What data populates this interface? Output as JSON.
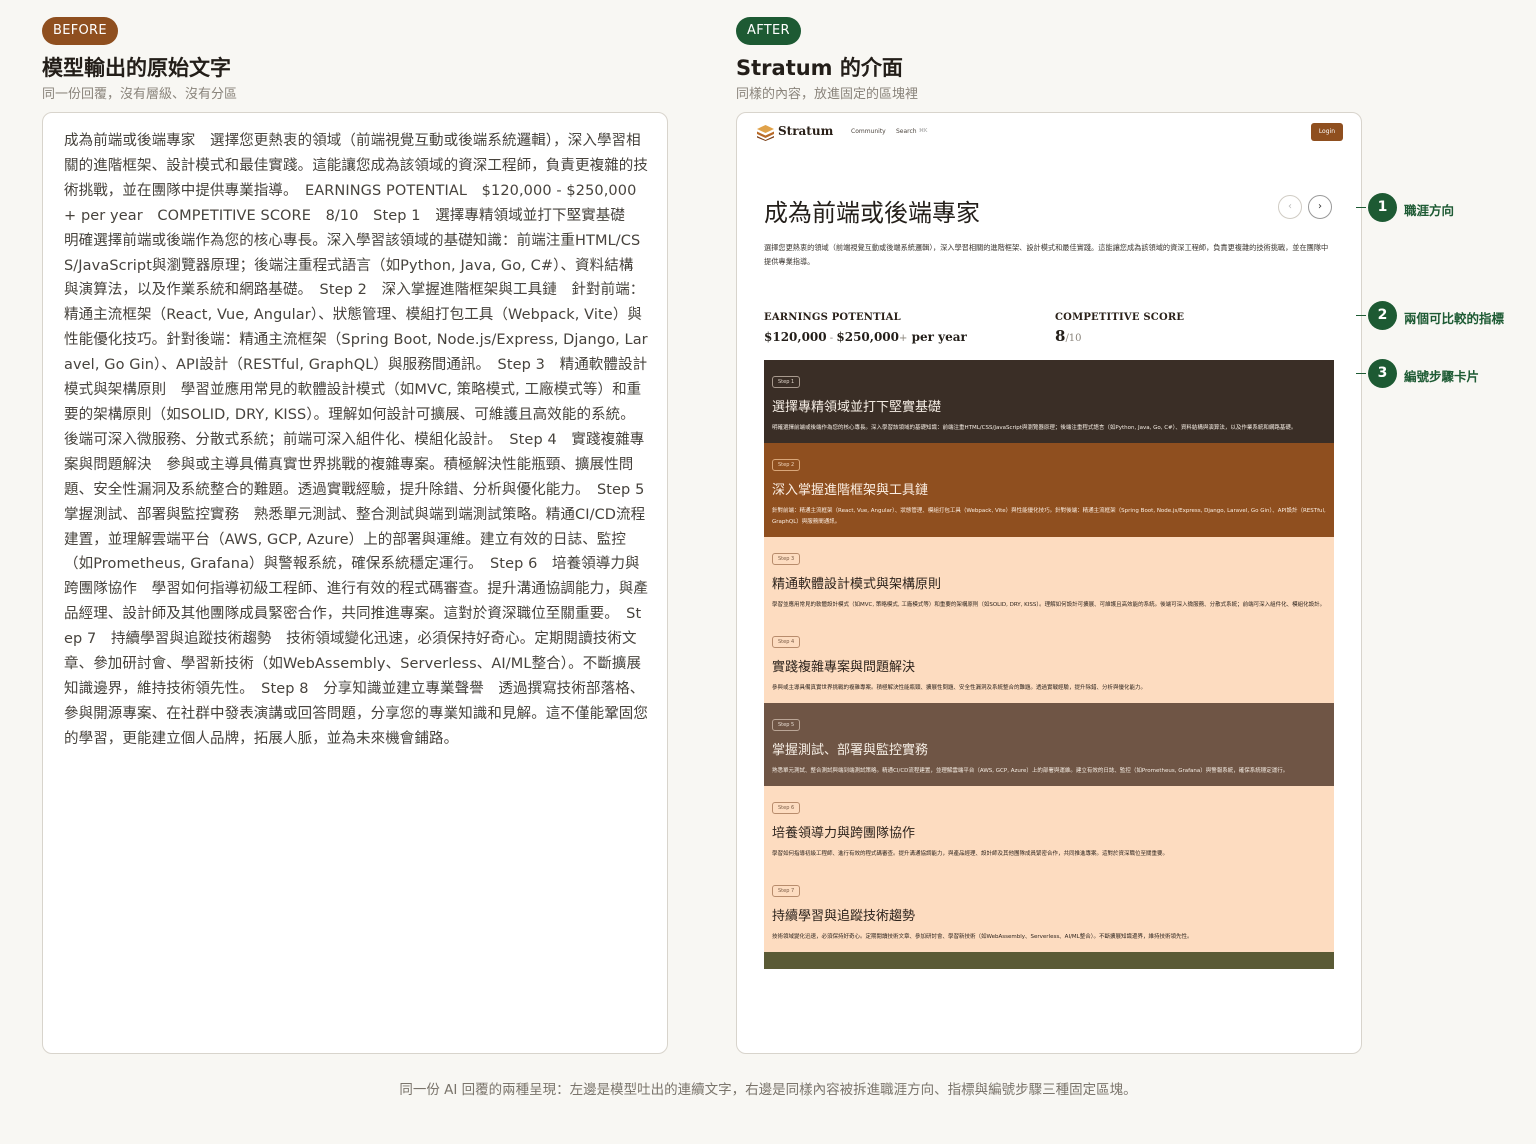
{
  "before": {
    "badge": "BEFORE",
    "title": "模型輸出的原始文字",
    "subtitle": "同一份回覆，沒有層級、沒有分區",
    "raw_text": "成為前端或後端專家　選擇您更熱衷的領域（前端視覺互動或後端系統邏輯），深入學習相關的進階框架、設計模式和最佳實踐。這能讓您成為該領域的資深工程師，負責更複雜的技術挑戰，並在團隊中提供專業指導。　EARNINGS POTENTIAL　$120,000 - $250,000+ per year　COMPETITIVE SCORE　8/10　Step 1　選擇專精領域並打下堅實基礎　明確選擇前端或後端作為您的核心專長。深入學習該領域的基礎知識：前端注重HTML/CSS/JavaScript與瀏覽器原理；後端注重程式語言（如Python, Java, Go, C#）、資料結構與演算法，以及作業系統和網路基礎。　Step 2　深入掌握進階框架與工具鏈　針對前端：精通主流框架（React, Vue, Angular）、狀態管理、模組打包工具（Webpack, Vite）與性能優化技巧。針對後端：精通主流框架（Spring Boot, Node.js/Express, Django, Laravel, Go Gin）、API設計（RESTful, GraphQL）與服務間通訊。　Step 3　精通軟體設計模式與架構原則　學習並應用常見的軟體設計模式（如MVC, 策略模式, 工廠模式等）和重要的架構原則（如SOLID, DRY, KISS）。理解如何設計可擴展、可維護且高效能的系統。後端可深入微服務、分散式系統；前端可深入組件化、模組化設計。　Step 4　實踐複雜專案與問題解決　參與或主導具備真實世界挑戰的複雜專案。積極解決性能瓶頸、擴展性問題、安全性漏洞及系統整合的難題。透過實戰經驗，提升除錯、分析與優化能力。　Step 5　掌握測試、部署與監控實務　熟悉單元測試、整合測試與端到端測試策略。精通CI/CD流程建置，並理解雲端平台（AWS, GCP, Azure）上的部署與運維。建立有效的日誌、監控（如Prometheus, Grafana）與警報系統，確保系統穩定運行。　Step 6　培養領導力與跨團隊協作　學習如何指導初級工程師、進行有效的程式碼審查。提升溝通協調能力，與產品經理、設計師及其他團隊成員緊密合作，共同推進專案。這對於資深職位至關重要。　Step 7　持續學習與追蹤技術趨勢　技術領域變化迅速，必須保持好奇心。定期閱讀技術文章、參加研討會、學習新技術（如WebAssembly、Serverless、AI/ML整合）。不斷擴展知識邊界，維持技術領先性。　Step 8　分享知識並建立專業聲譽　透過撰寫技術部落格、參與開源專案、在社群中發表演講或回答問題，分享您的專業知識和見解。這不僅能鞏固您的學習，更能建立個人品牌，拓展人脈，並為未來機會鋪路。"
  },
  "after": {
    "badge": "AFTER",
    "title": "Stratum 的介面",
    "subtitle": "同樣的內容，放進固定的區塊裡",
    "app": {
      "logo": "Stratum",
      "nav": {
        "community": "Community",
        "search": "Search",
        "search_kbd": "⌘K",
        "login": "Login"
      },
      "hero_title": "成為前端或後端專家",
      "prev_icon": "‹",
      "next_icon": "›",
      "hero_desc": "選擇您更熱衷的領域（前端視覺互動或後端系統邏輯），深入學習相關的進階框架、設計模式和最佳實踐。這能讓您成為該領域的資深工程師，負責更複雜的技術挑戰，並在團隊中提供專業指導。",
      "earnings": {
        "label": "EARNINGS POTENTIAL",
        "min": "$120,000",
        "sep": " - ",
        "max": "$250,000",
        "plus": "+",
        "unit": " per year"
      },
      "competitive": {
        "label": "COMPETITIVE SCORE",
        "score": "8",
        "of": "/10"
      },
      "steps": [
        {
          "tag": "Step 1",
          "title": "選擇專精領域並打下堅實基礎",
          "desc": "明確選擇前端或後端作為您的核心專長。深入學習該領域的基礎知識：前端注重HTML/CSS/JavaScript與瀏覽器原理；後端注重程式語言（如Python, Java, Go, C#）、資料結構與演算法，以及作業系統和網路基礎。"
        },
        {
          "tag": "Step 2",
          "title": "深入掌握進階框架與工具鏈",
          "desc": "針對前端：精通主流框架（React, Vue, Angular）、狀態管理、模組打包工具（Webpack, Vite）與性能優化技巧。針對後端：精通主流框架（Spring Boot, Node.js/Express, Django, Laravel, Go Gin）、API設計（RESTful, GraphQL）與服務間通訊。"
        },
        {
          "tag": "Step 3",
          "title": "精通軟體設計模式與架構原則",
          "desc": "學習並應用常見的軟體設計模式（如MVC, 策略模式, 工廠模式等）和重要的架構原則（如SOLID, DRY, KISS）。理解如何設計可擴展、可維護且高效能的系統。後端可深入微服務、分散式系統；前端可深入組件化、模組化設計。"
        },
        {
          "tag": "Step 4",
          "title": "實踐複雜專案與問題解決",
          "desc": "參與或主導具備真實世界挑戰的複雜專案。積極解決性能瓶頸、擴展性問題、安全性漏洞及系統整合的難題。透過實戰經驗，提升除錯、分析與優化能力。"
        },
        {
          "tag": "Step 5",
          "title": "掌握測試、部署與監控實務",
          "desc": "熟悉單元測試、整合測試與端到端測試策略。精通CI/CD流程建置，並理解雲端平台（AWS, GCP, Azure）上的部署與運維。建立有效的日誌、監控（如Prometheus, Grafana）與警報系統，確保系統穩定運行。"
        },
        {
          "tag": "Step 6",
          "title": "培養領導力與跨團隊協作",
          "desc": "學習如何指導初級工程師、進行有效的程式碼審查。提升溝通協調能力，與產品經理、設計師及其他團隊成員緊密合作，共同推進專案。這對於資深職位至關重要。"
        },
        {
          "tag": "Step 7",
          "title": "持續學習與追蹤技術趨勢",
          "desc": "技術領域變化迅速，必須保持好奇心。定期閱讀技術文章、參加研討會、學習新技術（如WebAssembly、Serverless、AI/ML整合）。不斷擴展知識邊界，維持技術領先性。"
        }
      ]
    }
  },
  "callouts": [
    {
      "num": "1",
      "label": "職涯方向"
    },
    {
      "num": "2",
      "label": "兩個可比較的指標"
    },
    {
      "num": "3",
      "label": "編號步驟卡片"
    }
  ],
  "caption": "同一份 AI 回覆的兩種呈現：左邊是模型吐出的連續文字，右邊是同樣內容被拆進職涯方向、指標與編號步驟三種固定區塊。",
  "colors": {
    "before_badge": "#8f4f1f",
    "after_badge": "#1d5a33",
    "accent": "#1d5a33"
  }
}
